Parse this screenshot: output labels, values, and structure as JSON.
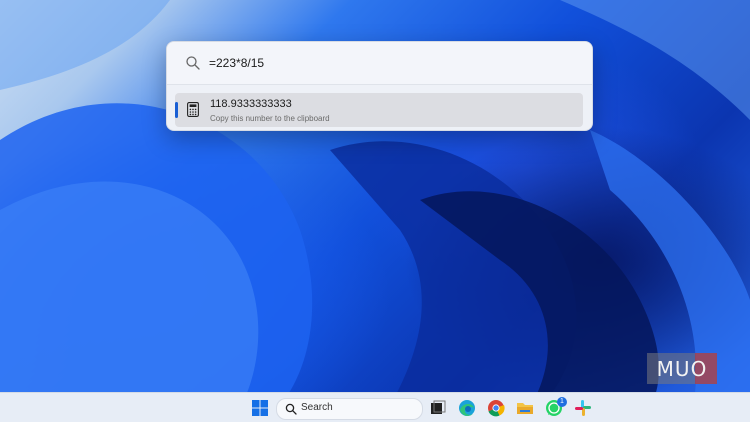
{
  "run_dialog": {
    "query": "=223*8/15",
    "result": {
      "value": "118.9333333333",
      "subtitle": "Copy this number to the clipboard"
    }
  },
  "watermark": {
    "text": "MUO"
  },
  "taskbar": {
    "search_label": "Search",
    "apps": [
      "start-icon",
      "search-icon",
      "task-view-icon",
      "edge-icon",
      "chrome-icon",
      "file-explorer-icon",
      "whatsapp-icon",
      "slack-icon"
    ],
    "whatsapp_badge": "1"
  },
  "colors": {
    "accent": "#1a5fd4",
    "wallpaper_blue": "#1150db",
    "taskbar_bg": "#e7edf6"
  }
}
